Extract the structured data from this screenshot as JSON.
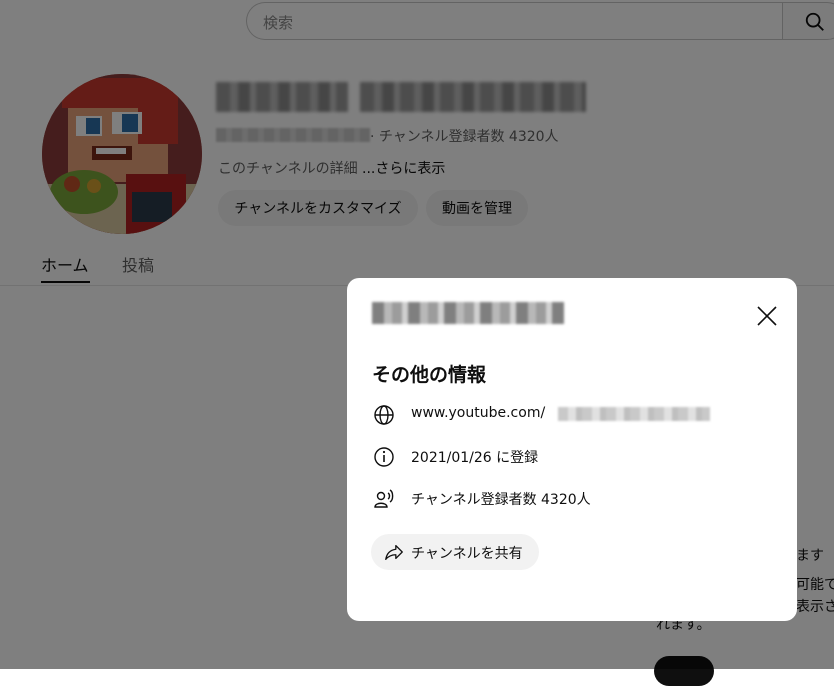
{
  "header": {
    "search_placeholder": "検索",
    "search_icon": "search-icon"
  },
  "channel": {
    "subscribers_line": "· チャンネル登録者数 4320人",
    "description": "このチャンネルの詳細 ",
    "description_more": "...さらに表示",
    "customize_label": "チャンネルをカスタマイズ",
    "manage_label": "動画を管理"
  },
  "tabs": [
    {
      "label": "ホーム",
      "active": true
    },
    {
      "label": "投稿",
      "active": false
    }
  ],
  "background_fragments": {
    "line1": "ます",
    "line2": "可能で",
    "line3": "表示さ",
    "line4": "れます。"
  },
  "dialog": {
    "title": "その他の情報",
    "close_icon": "close-icon",
    "url_prefix": "www.youtube.com/",
    "joined": "2021/01/26 に登録",
    "subscribers": "チャンネル登録者数 4320人",
    "share_label": "チャンネルを共有"
  },
  "colors": {
    "overlay": "#000000",
    "pill_bg": "#f2f2f2",
    "text_primary": "#0f0f0f",
    "text_secondary": "#606060"
  }
}
